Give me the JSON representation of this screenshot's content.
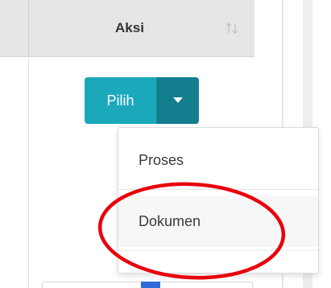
{
  "table": {
    "header": {
      "column_label": "Aksi",
      "sort_icon": "sort-arrows-icon"
    }
  },
  "split_button": {
    "label": "Pilih",
    "toggle_icon": "caret-down-icon",
    "color": "#1ba8bb",
    "toggle_color": "#137f8e"
  },
  "dropdown": {
    "items": [
      {
        "label": "Proses"
      },
      {
        "label": "Dokumen"
      }
    ]
  },
  "annotation": {
    "shape": "ellipse",
    "color": "#e8000b",
    "target": "Dokumen"
  }
}
